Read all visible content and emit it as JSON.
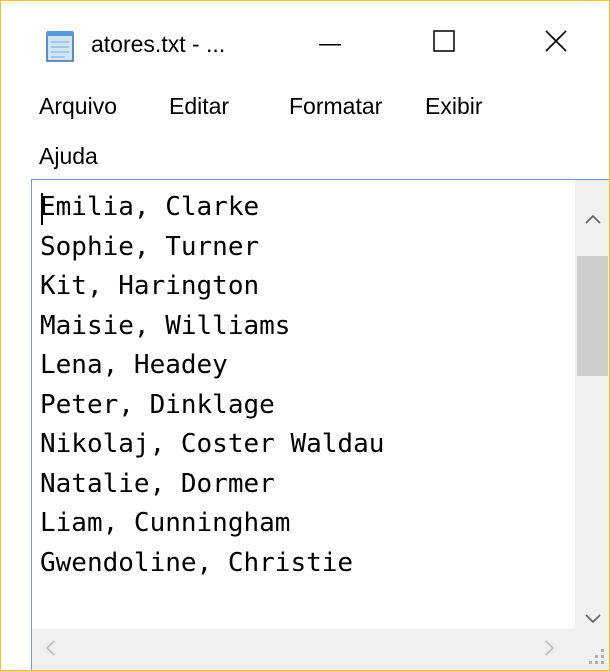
{
  "window": {
    "title": "atores.txt - ...",
    "icon": "notepad-icon",
    "border_color": "#f0c419"
  },
  "caption_buttons": {
    "minimize_icon": "minimize-icon",
    "maximize_icon": "maximize-icon",
    "close_icon": "close-icon"
  },
  "menu": {
    "items": [
      {
        "label": "Arquivo"
      },
      {
        "label": "Editar"
      },
      {
        "label": "Formatar"
      },
      {
        "label": "Exibir"
      },
      {
        "label": "Ajuda"
      }
    ]
  },
  "editor": {
    "lines": [
      "Emilia, Clarke",
      "Sophie, Turner",
      "Kit, Harington",
      "Maisie, Williams",
      "Lena, Headey",
      "Peter, Dinklage",
      "Nikolaj, Coster Waldau",
      "Natalie, Dormer",
      "Liam, Cunningham",
      "Gwendoline, Christie"
    ]
  },
  "scrollbars": {
    "vertical": {
      "up_icon": "chevron-up-icon",
      "down_icon": "chevron-down-icon"
    },
    "horizontal": {
      "left_icon": "chevron-left-icon",
      "right_icon": "chevron-right-icon"
    },
    "grip_icon": "size-grip-icon"
  }
}
